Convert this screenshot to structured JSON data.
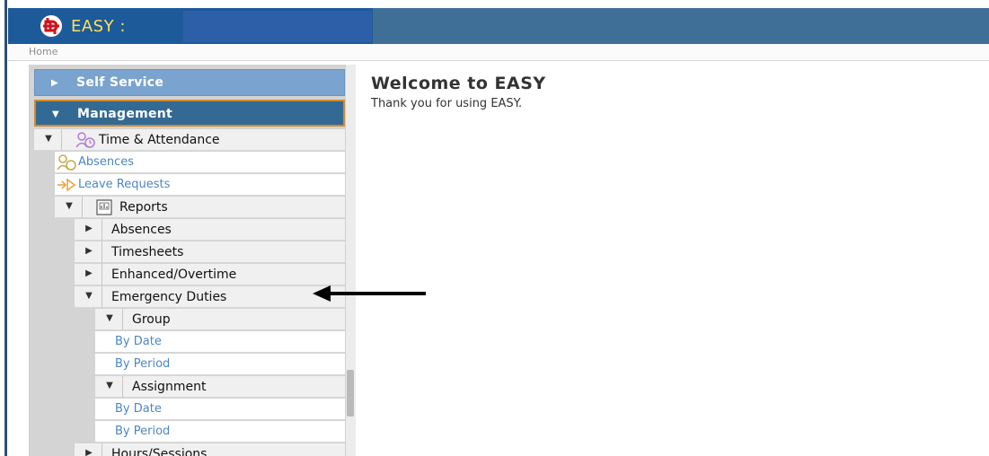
{
  "header": {
    "app_title": "EASY :",
    "logo_icon": "easy-logo-icon",
    "header_color": "#3f6f96",
    "title_color": "#ffe15a"
  },
  "breadcrumb": {
    "home": "Home"
  },
  "sidebar": {
    "self_service": "Self Service",
    "management": "Management",
    "time_attendance": "Time & Attendance",
    "absences_link": "Absences",
    "leave_requests_link": "Leave Requests",
    "reports": "Reports",
    "reports_children": {
      "absences": "Absences",
      "timesheets": "Timesheets",
      "enhanced_overtime": "Enhanced/Overtime",
      "emergency_duties": "Emergency Duties",
      "group": "Group",
      "group_by_date": "By Date",
      "group_by_period": "By Period",
      "assignment": "Assignment",
      "assignment_by_date": "By Date",
      "assignment_by_period": "By Period",
      "hours_sessions": "Hours/Sessions"
    },
    "accent_color": "#336a93",
    "link_color": "#4c87c2"
  },
  "content": {
    "welcome_title": "Welcome to EASY",
    "thanks_text": "Thank you for using EASY."
  }
}
